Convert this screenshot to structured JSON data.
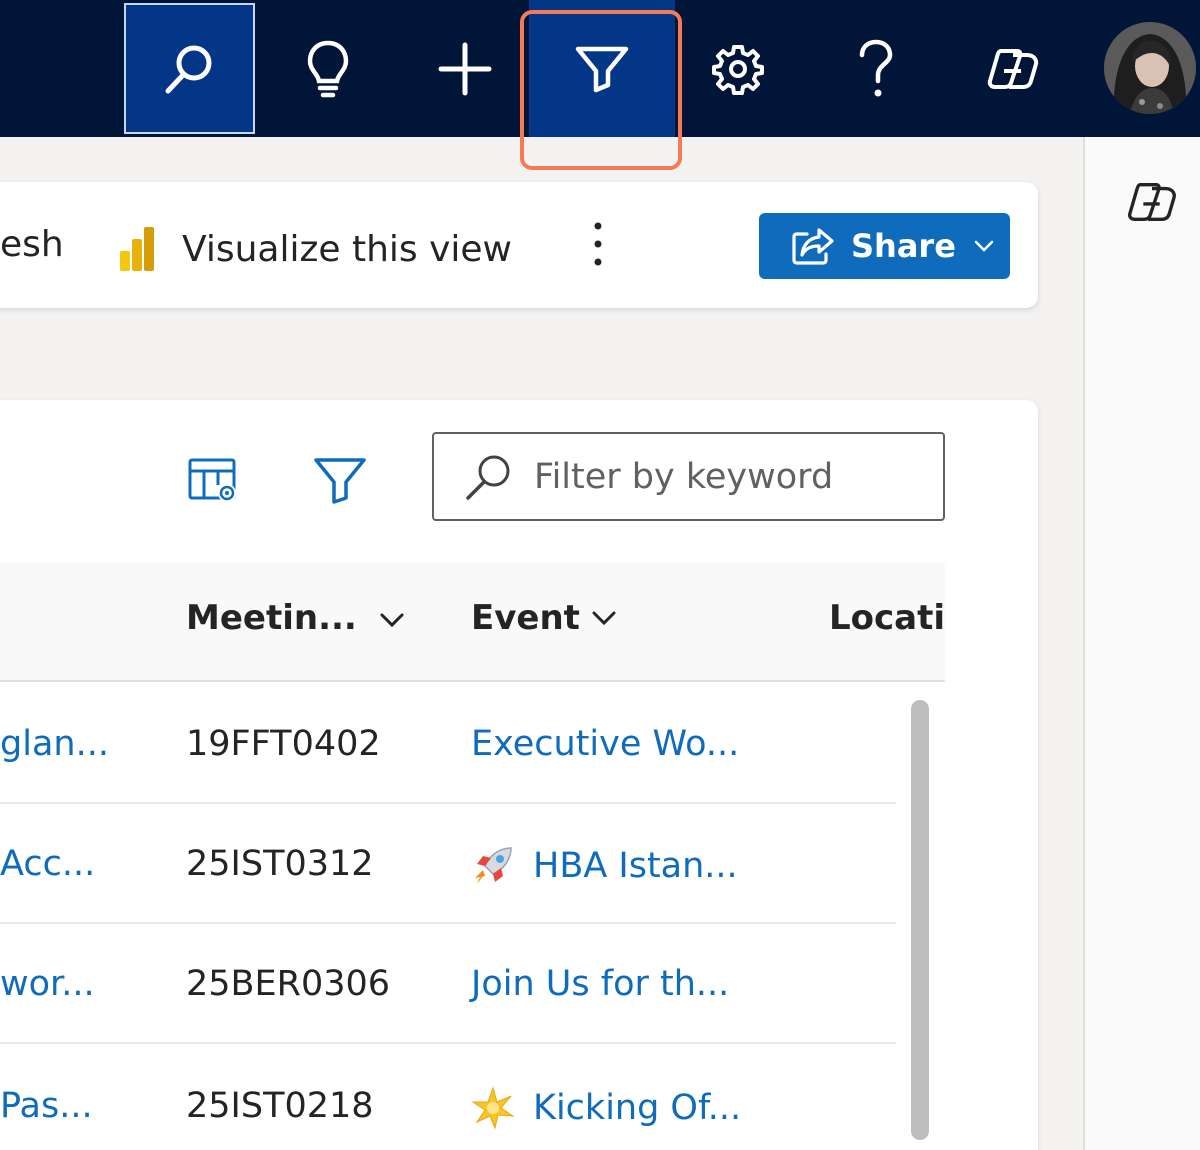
{
  "topbar": {
    "search_label": "Search",
    "tips_label": "Tips",
    "new_label": "New",
    "filter_label": "Advanced filter",
    "settings_label": "Settings",
    "help_label": "Help",
    "copilot_label": "Copilot"
  },
  "commandbar": {
    "refresh_label": "esh",
    "visualize_label": "Visualize this view",
    "share_label": "Share"
  },
  "grid": {
    "keyword_placeholder": "Filter by keyword",
    "columns": {
      "meeting": "Meetin...",
      "event": "Event",
      "location": "Locatic"
    },
    "rows": [
      {
        "name": "glan...",
        "code": "19FFT0402",
        "event": "Executive Wo...",
        "emoji": ""
      },
      {
        "name": " Acc...",
        "code": "25IST0312",
        "event": "HBA Istan...",
        "emoji": "rocket"
      },
      {
        "name": "wor...",
        "code": "25BER0306",
        "event": "Join Us for th...",
        "emoji": ""
      },
      {
        "name": " Pas...",
        "code": "25IST0218",
        "event": "Kicking Of...",
        "emoji": "sparkle"
      }
    ]
  },
  "colors": {
    "topbar_bg": "#001537",
    "active_btn": "#043688",
    "highlight": "#f47b55",
    "brand_blue": "#0f6cbd"
  }
}
